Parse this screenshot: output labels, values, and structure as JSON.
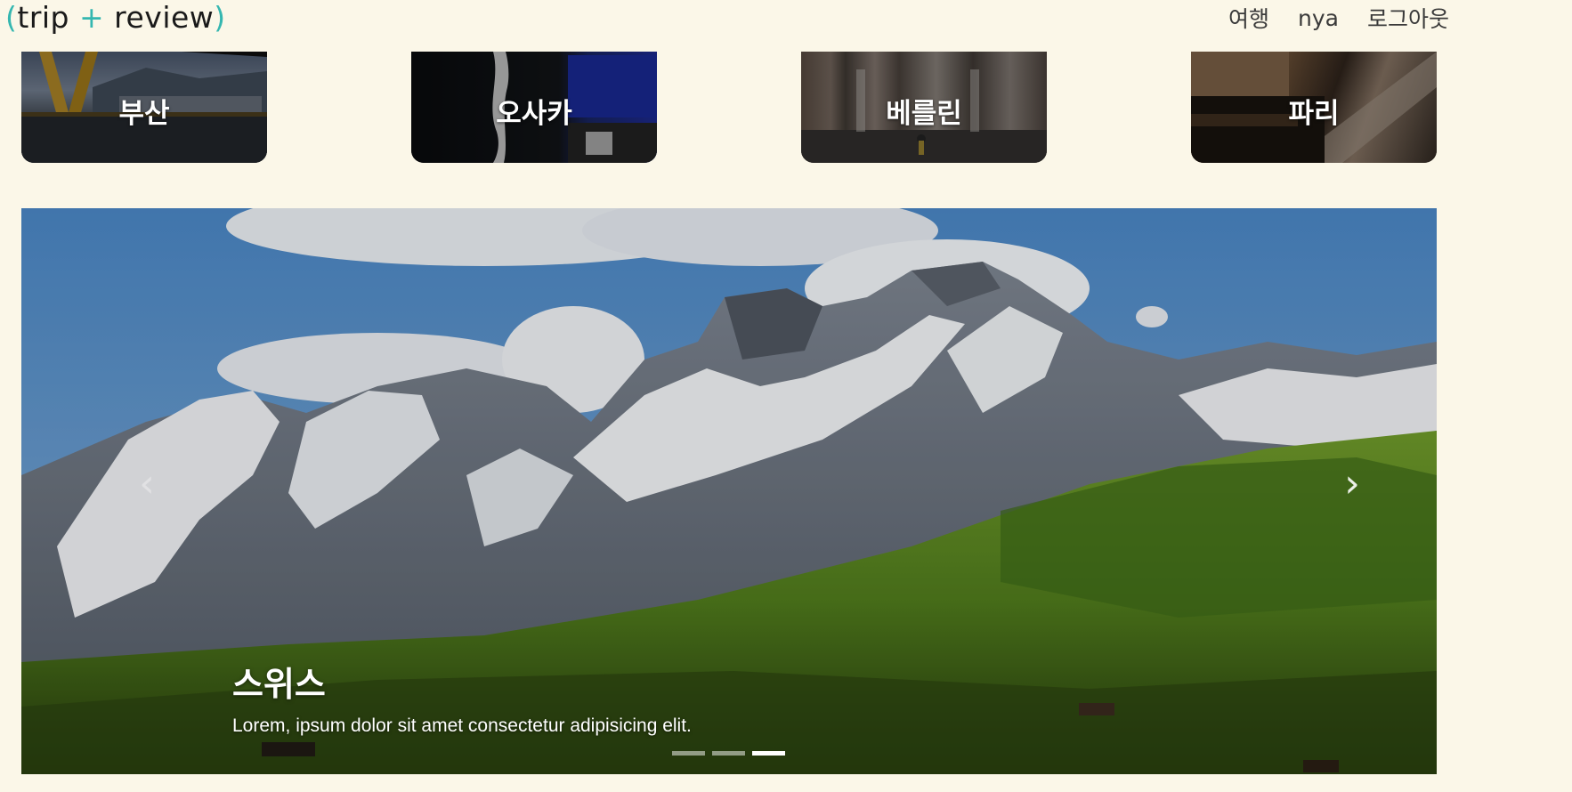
{
  "header": {
    "logo": {
      "open": "(",
      "word1": "trip",
      "plus": "+",
      "word2": "review",
      "close": ")"
    },
    "nav": [
      {
        "label": "여행"
      },
      {
        "label": "nya"
      },
      {
        "label": "로그아웃"
      }
    ]
  },
  "cities": [
    {
      "label": "부산"
    },
    {
      "label": "오사카"
    },
    {
      "label": "베를린"
    },
    {
      "label": "파리"
    }
  ],
  "carousel": {
    "title": "스위스",
    "text": "Lorem, ipsum dolor sit amet consectetur adipisicing elit.",
    "prev_icon": "chevron-left-icon",
    "next_icon": "chevron-right-icon",
    "prev_glyph": "‹",
    "next_glyph": "›",
    "slide_count": 3,
    "active_index": 2
  },
  "colors": {
    "background": "#fbf7e8",
    "accent": "#35b7b0"
  }
}
